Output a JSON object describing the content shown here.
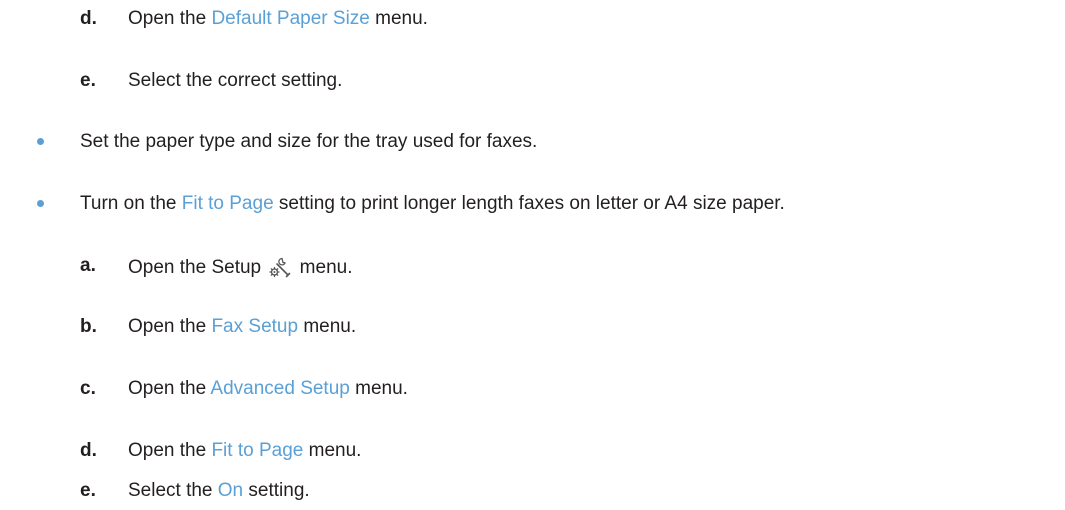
{
  "steps_group1": [
    {
      "marker": "d.",
      "pre": "Open the ",
      "link": "Default Paper Size",
      "post": " menu."
    },
    {
      "marker": "e.",
      "pre": "Select the correct setting.",
      "link": "",
      "post": ""
    }
  ],
  "bullets": [
    {
      "pre": "Set the paper type and size for the tray used for faxes.",
      "link": "",
      "post": ""
    },
    {
      "pre": "Turn on the ",
      "link": "Fit to Page",
      "post": " setting to print longer length faxes on letter or A4 size paper."
    }
  ],
  "steps_group2": [
    {
      "marker": "a.",
      "pre": "Open the Setup ",
      "icon": "setup-wrench-gear-icon",
      "post": " menu."
    },
    {
      "marker": "b.",
      "pre": "Open the ",
      "link": "Fax Setup",
      "post": " menu."
    },
    {
      "marker": "c.",
      "pre": "Open the ",
      "link": "Advanced Setup",
      "post": " menu."
    },
    {
      "marker": "d.",
      "pre": "Open the ",
      "link": "Fit to Page",
      "post": " menu."
    },
    {
      "marker": "e.",
      "pre": "Select the ",
      "link": "On",
      "post": " setting."
    }
  ],
  "colors": {
    "text": "#231f20",
    "link": "#5aa0d6",
    "bullet": "#5aa0d6"
  }
}
